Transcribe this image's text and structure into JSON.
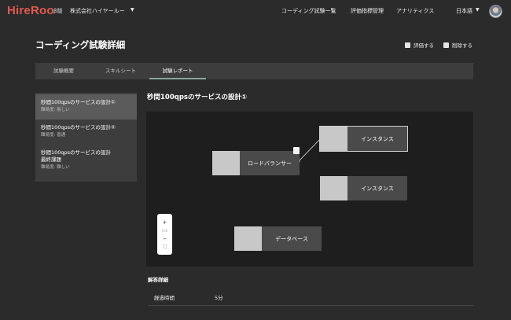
{
  "header": {
    "logo": "HireRoo",
    "beta": "β版",
    "company": "株式会社ハイヤールー",
    "nav": [
      "コーディング試験一覧",
      "評価指標管理",
      "アナリティクス"
    ],
    "language": "日本語"
  },
  "page": {
    "title": "コーディング試験詳細",
    "actions": {
      "evaluate": "評価する",
      "delete": "削除する"
    }
  },
  "tabs": [
    "試験概要",
    "スキルシート",
    "試験レポート"
  ],
  "active_tab": "試験レポート",
  "questions": [
    {
      "title": "秒間100qpsのサービスの設計①",
      "difficulty": "難易度: 易しい"
    },
    {
      "title": "秒間100qpsのサービスの設計②",
      "difficulty": "難易度: 普通"
    },
    {
      "title_line1": "秒間100qpsのサービスの設計",
      "title_line2": "最終課題",
      "difficulty": "難易度: 難しい"
    }
  ],
  "question_heading": "秒間100qpsのサービスの設計①",
  "diagram": {
    "nodes": {
      "load_balancer": "ロードバランサー",
      "instance_1": "インスタンス",
      "instance_2": "インスタンス",
      "database": "データベース"
    },
    "zoom_controls": [
      "+",
      "100",
      "−",
      "⛶"
    ]
  },
  "answer": {
    "title": "解答詳細",
    "elapsed_label": "経過時間",
    "elapsed_value": "5分"
  }
}
